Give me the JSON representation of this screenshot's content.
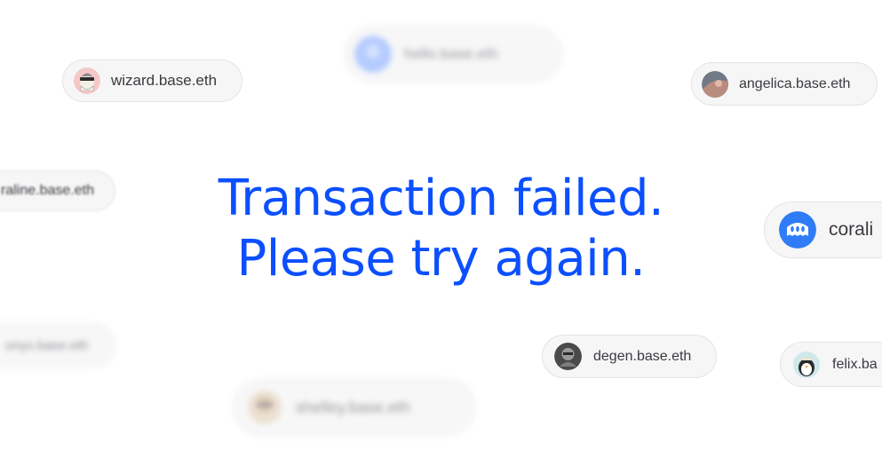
{
  "colors": {
    "headline": "#0b4fff",
    "pill_background": "#f6f6f7",
    "pill_border": "#e4e4e7",
    "pill_text": "#3a3a3f"
  },
  "message": {
    "line1": "Transaction failed.",
    "line2": "Please try again."
  },
  "pills": {
    "bottom_left": {
      "name": "shelley.base.eth",
      "avatar_icon": "avatar-icon",
      "blurred": true
    },
    "degen": {
      "name": "degen.base.eth",
      "avatar_icon": "avatar-icon"
    },
    "felix": {
      "name": "felix.ba",
      "avatar_icon": "penguin-avatar-icon"
    },
    "coral_right": {
      "name": "corali",
      "avatar_icon": "ghost-avatar-icon"
    },
    "wizard": {
      "name": "wizard.base.eth",
      "avatar_icon": "wizard-avatar-icon"
    },
    "angelica": {
      "name": "angelica.base.eth",
      "avatar_icon": "avatar-icon"
    },
    "top_center": {
      "name": "hello.base.eth",
      "avatar_icon": "avatar-icon",
      "blurred": true
    },
    "coraline_left": {
      "name": "raline.base.eth",
      "blurred": true
    },
    "onyx": {
      "name": "onyx.base.eth",
      "blurred": true
    }
  }
}
